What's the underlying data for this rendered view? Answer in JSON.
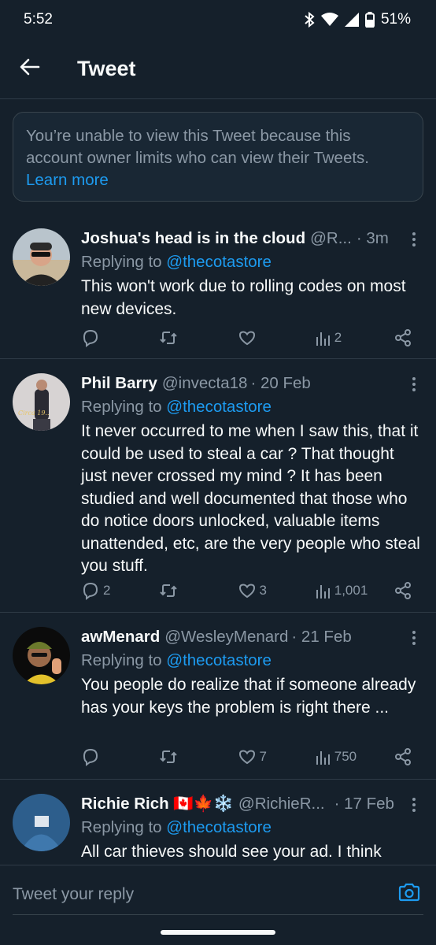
{
  "status_bar": {
    "time": "5:52",
    "battery": "51%"
  },
  "header": {
    "title": "Tweet"
  },
  "notice": {
    "text": "You’re unable to view this Tweet because this account owner limits who can view their Tweets.",
    "link": "Learn more"
  },
  "tweets": [
    {
      "name": "Joshua's head is in the cloud",
      "handle": "@R...",
      "time": "· 3m",
      "replying_prefix": "Replying to ",
      "replying_to": "@thecotastore",
      "text": "This won't work due to rolling codes on most new devices.",
      "replies": "",
      "retweets": "",
      "likes": "",
      "views": "2"
    },
    {
      "name": "Phil Barry",
      "handle": "@invecta18",
      "time": "· 20 Feb",
      "replying_prefix": "Replying to ",
      "replying_to": "@thecotastore",
      "text": "It never occurred to me when I saw this, that it could be used to steal a car ? That thought just never crossed my mind ? It has been studied and well documented that those who do notice doors unlocked, valuable items unattended, etc, are the very people who steal you stuff.",
      "replies": "2",
      "retweets": "",
      "likes": "3",
      "views": "1,001",
      "avatar_text": "Circa 19.."
    },
    {
      "name": "awMenard",
      "handle": "@WesleyMenard",
      "time": "· 21 Feb",
      "replying_prefix": "Replying to ",
      "replying_to": "@thecotastore",
      "text": "You people do realize that if someone already has your keys the problem is right there ...",
      "replies": "",
      "retweets": "",
      "likes": "7",
      "views": "750"
    },
    {
      "name": "Richie Rich 🇨🇦🍁❄️",
      "handle": "@RichieR...",
      "time": "· 17 Feb",
      "replying_prefix": "Replying to ",
      "replying_to": "@thecotastore",
      "text": "All car thieves should see your ad.  I think"
    }
  ],
  "reply_bar": {
    "placeholder": "Tweet your reply"
  },
  "colors": {
    "background": "#15202b",
    "accent": "#1d9bf0",
    "muted": "#8b98a5",
    "border": "#2f3b47"
  },
  "icons": [
    "back-arrow-icon",
    "bluetooth-icon",
    "wifi-icon",
    "signal-icon",
    "battery-icon",
    "more-icon",
    "reply-icon",
    "retweet-icon",
    "like-icon",
    "views-icon",
    "share-icon",
    "camera-icon"
  ]
}
